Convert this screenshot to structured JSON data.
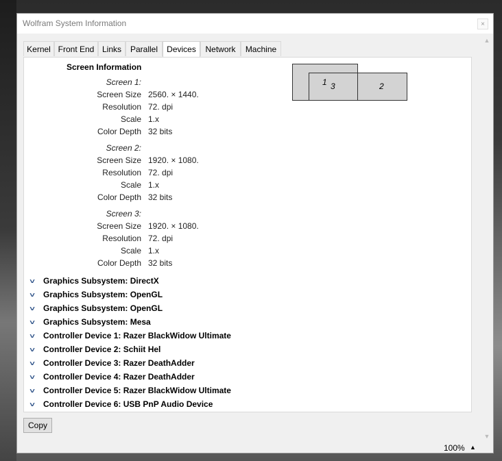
{
  "window": {
    "title": "Wolfram System Information",
    "title_button": "×"
  },
  "tabs": [
    {
      "label": "Kernel"
    },
    {
      "label": "Front End"
    },
    {
      "label": "Links"
    },
    {
      "label": "Parallel"
    },
    {
      "label": "Devices"
    },
    {
      "label": "Network"
    },
    {
      "label": "Machine"
    }
  ],
  "active_tab": "Devices",
  "screen_info": {
    "title": "Screen Information",
    "screens": [
      {
        "label": "Screen 1:",
        "size": "2560. × 1440.",
        "resolution": "72. dpi",
        "scale": "1.x",
        "depth": "32 bits"
      },
      {
        "label": "Screen 2:",
        "size": "1920. × 1080.",
        "resolution": "72. dpi",
        "scale": "1.x",
        "depth": "32 bits"
      },
      {
        "label": "Screen 3:",
        "size": "1920. × 1080.",
        "resolution": "72. dpi",
        "scale": "1.x",
        "depth": "32 bits"
      }
    ],
    "prop_labels": {
      "size": "Screen Size",
      "resolution": "Resolution",
      "scale": "Scale",
      "depth": "Color Depth"
    },
    "diagram_numbers": [
      "1",
      "3",
      "2"
    ]
  },
  "groups": [
    "Graphics Subsystem: DirectX",
    "Graphics Subsystem: OpenGL",
    "Graphics Subsystem: OpenGL",
    "Graphics Subsystem: Mesa",
    "Controller Device 1: Razer BlackWidow Ultimate",
    "Controller Device 2: Schiit Hel",
    "Controller Device 3: Razer DeathAdder",
    "Controller Device 4: Razer DeathAdder",
    "Controller Device 5: Razer BlackWidow Ultimate",
    "Controller Device 6: USB PnP Audio Device"
  ],
  "chevron_glyph": "˅",
  "copy_label": "Copy",
  "zoom": {
    "value": "100%",
    "arrow": "▲"
  }
}
